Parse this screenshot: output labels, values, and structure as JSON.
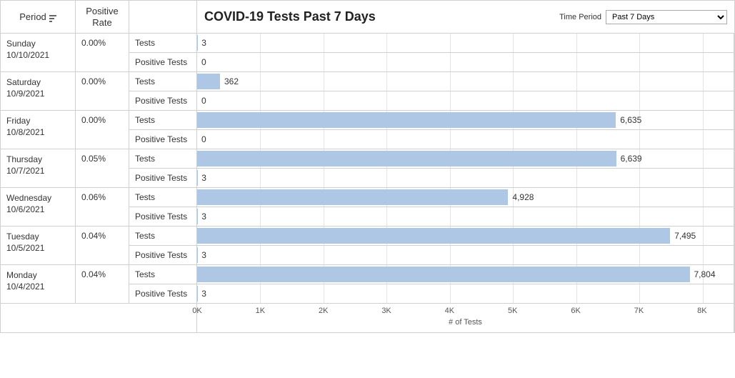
{
  "header": {
    "period_col": "Period",
    "rate_col": "Positive Rate",
    "title": "COVID-19 Tests Past 7 Days",
    "time_period_label": "Time Period",
    "time_period_value": "Past 7 Days"
  },
  "metric_labels": {
    "tests": "Tests",
    "positive": "Positive Tests"
  },
  "axis": {
    "title": "# of Tests",
    "ticks": [
      "0K",
      "1K",
      "2K",
      "3K",
      "4K",
      "5K",
      "6K",
      "7K",
      "8K"
    ],
    "max": 8500
  },
  "rows": [
    {
      "day": "Sunday",
      "date": "10/10/2021",
      "rate": "0.00%",
      "tests": 3,
      "tests_label": "3",
      "positive": 0,
      "positive_label": "0"
    },
    {
      "day": "Saturday",
      "date": "10/9/2021",
      "rate": "0.00%",
      "tests": 362,
      "tests_label": "362",
      "positive": 0,
      "positive_label": "0"
    },
    {
      "day": "Friday",
      "date": "10/8/2021",
      "rate": "0.00%",
      "tests": 6635,
      "tests_label": "6,635",
      "positive": 0,
      "positive_label": "0"
    },
    {
      "day": "Thursday",
      "date": "10/7/2021",
      "rate": "0.05%",
      "tests": 6639,
      "tests_label": "6,639",
      "positive": 3,
      "positive_label": "3"
    },
    {
      "day": "Wednesday",
      "date": "10/6/2021",
      "rate": "0.06%",
      "tests": 4928,
      "tests_label": "4,928",
      "positive": 3,
      "positive_label": "3"
    },
    {
      "day": "Tuesday",
      "date": "10/5/2021",
      "rate": "0.04%",
      "tests": 7495,
      "tests_label": "7,495",
      "positive": 3,
      "positive_label": "3"
    },
    {
      "day": "Monday",
      "date": "10/4/2021",
      "rate": "0.04%",
      "tests": 7804,
      "tests_label": "7,804",
      "positive": 3,
      "positive_label": "3"
    }
  ],
  "chart_data": {
    "type": "bar",
    "title": "COVID-19 Tests Past 7 Days",
    "xlabel": "# of Tests",
    "ylabel": "Period",
    "xlim": [
      0,
      8500
    ],
    "categories": [
      "Sunday 10/10/2021",
      "Saturday 10/9/2021",
      "Friday 10/8/2021",
      "Thursday 10/7/2021",
      "Wednesday 10/6/2021",
      "Tuesday 10/5/2021",
      "Monday 10/4/2021"
    ],
    "series": [
      {
        "name": "Tests",
        "values": [
          3,
          362,
          6635,
          6639,
          4928,
          7495,
          7804
        ]
      },
      {
        "name": "Positive Tests",
        "values": [
          0,
          0,
          0,
          3,
          3,
          3,
          3
        ]
      }
    ],
    "positive_rate": [
      "0.00%",
      "0.00%",
      "0.00%",
      "0.05%",
      "0.06%",
      "0.04%",
      "0.04%"
    ]
  }
}
